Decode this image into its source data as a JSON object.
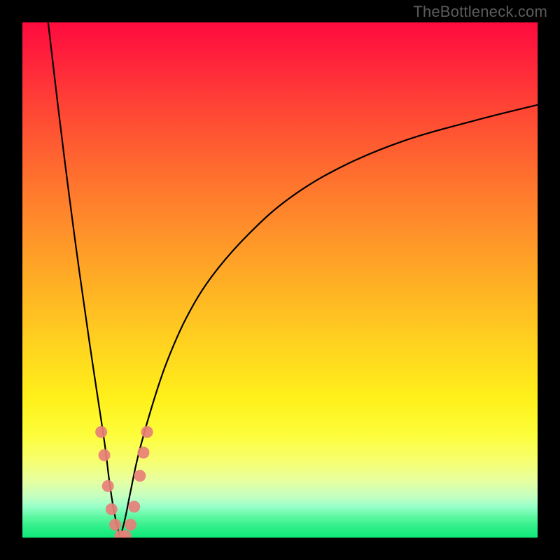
{
  "watermark": "TheBottleneck.com",
  "chart_data": {
    "type": "line",
    "title": "",
    "xlabel": "",
    "ylabel": "",
    "xlim": [
      0,
      100
    ],
    "ylim": [
      0,
      100
    ],
    "note": "Bottleneck-style V curve over a vertical severity gradient (red = high bottleneck at top, green = balanced at bottom). Two black curves descend into a sharp minimum around x≈19 where bottleneck ≈ 0, then the right curve rises toward an asymptote near ~85% on the far right. Salmon marker dots cluster around the minimum.",
    "series": [
      {
        "name": "left-branch",
        "x": [
          5,
          7,
          9,
          11,
          13,
          14.5,
          16,
          17,
          18,
          19
        ],
        "y": [
          100,
          83,
          67,
          52,
          38,
          28,
          18,
          10,
          4,
          0
        ]
      },
      {
        "name": "right-branch",
        "x": [
          19,
          20,
          21,
          22.5,
          25,
          28,
          32,
          37,
          44,
          52,
          62,
          74,
          88,
          100
        ],
        "y": [
          0,
          4,
          9,
          16,
          25,
          34,
          43,
          51,
          59,
          66,
          72,
          77,
          81,
          84
        ]
      }
    ],
    "markers": {
      "name": "near-minimum-points",
      "color": "#e77f78",
      "points": [
        {
          "x": 15.3,
          "y": 20.5
        },
        {
          "x": 15.9,
          "y": 16.0
        },
        {
          "x": 16.6,
          "y": 10.0
        },
        {
          "x": 17.3,
          "y": 5.5
        },
        {
          "x": 18.0,
          "y": 2.5
        },
        {
          "x": 19.0,
          "y": 0.3
        },
        {
          "x": 20.0,
          "y": 0.3
        },
        {
          "x": 21.0,
          "y": 2.5
        },
        {
          "x": 21.7,
          "y": 6.0
        },
        {
          "x": 22.8,
          "y": 12.0
        },
        {
          "x": 23.5,
          "y": 16.5
        },
        {
          "x": 24.2,
          "y": 20.5
        }
      ]
    },
    "gradient_stops": [
      {
        "pct": 0,
        "color": "#ff0b3e"
      },
      {
        "pct": 15,
        "color": "#ff3f36"
      },
      {
        "pct": 40,
        "color": "#ff8f2a"
      },
      {
        "pct": 63,
        "color": "#ffd41f"
      },
      {
        "pct": 80,
        "color": "#fdfd3a"
      },
      {
        "pct": 92,
        "color": "#c4ffc0"
      },
      {
        "pct": 100,
        "color": "#0ee878"
      }
    ]
  }
}
